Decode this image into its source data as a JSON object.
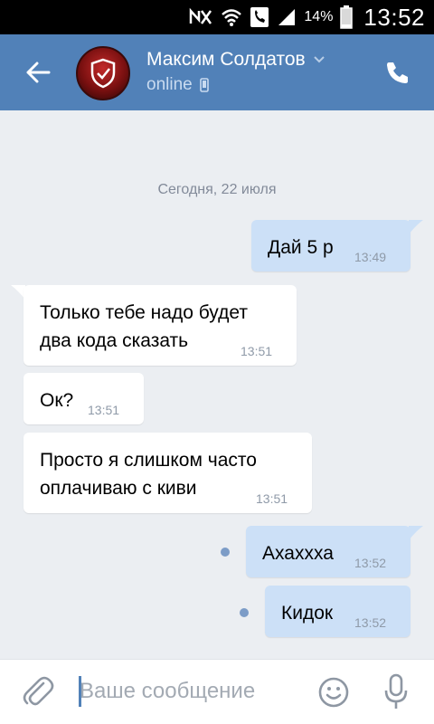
{
  "status_bar": {
    "battery": "14%",
    "time": "13:52"
  },
  "header": {
    "contact_name": "Максим Солдатов",
    "status": "online"
  },
  "chat": {
    "date_separator": "Сегодня, 22 июля",
    "messages": [
      {
        "direction": "out",
        "text": "Дай 5 р",
        "time": "13:49",
        "unread": false
      },
      {
        "direction": "in",
        "text": "Только тебе надо будет\nдва кода сказать",
        "time": "13:51"
      },
      {
        "direction": "in",
        "text": "Ок?",
        "time": "13:51"
      },
      {
        "direction": "in",
        "text": "Просто я слишком часто\nоплачиваю с киви",
        "time": "13:51"
      },
      {
        "direction": "out",
        "text": "Ахаххха",
        "time": "13:52",
        "unread": true
      },
      {
        "direction": "out",
        "text": "Кидок",
        "time": "13:52",
        "unread": true
      }
    ]
  },
  "composer": {
    "placeholder": "Ваше сообщение",
    "value": ""
  },
  "colors": {
    "header": "#5181b8",
    "outgoing": "#cce0f7",
    "incoming": "#ffffff",
    "background": "#ebeef2"
  }
}
